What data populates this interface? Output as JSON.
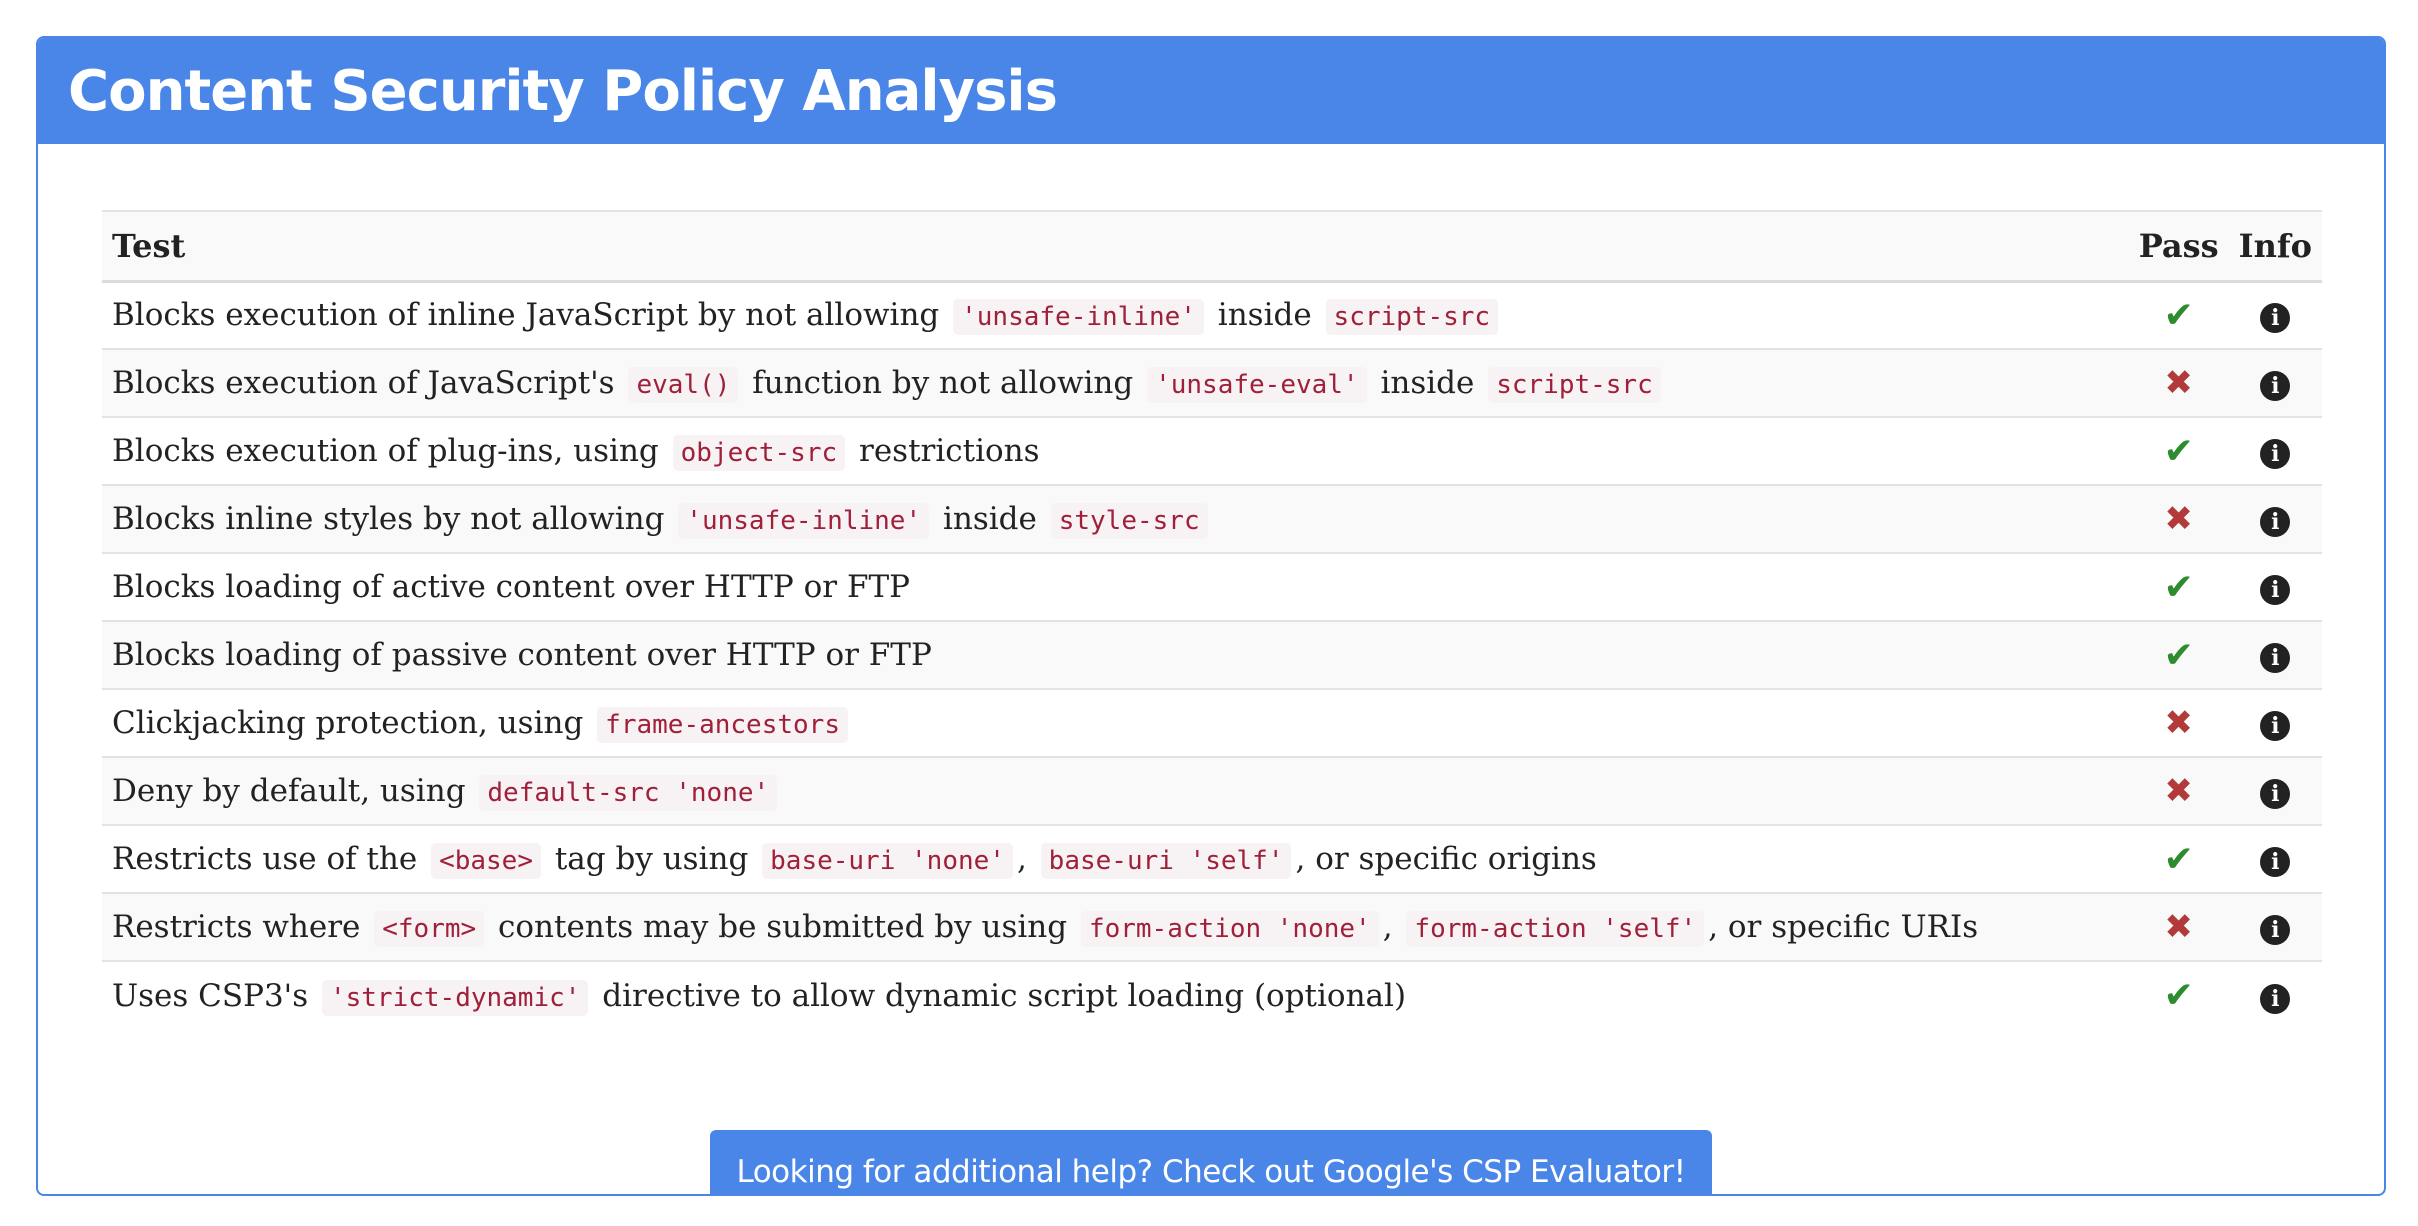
{
  "header": {
    "title": "Content Security Policy Analysis"
  },
  "table": {
    "columns": {
      "test": "Test",
      "pass": "Pass",
      "info": "Info"
    },
    "rows": [
      {
        "parts": [
          {
            "t": "Blocks execution of inline JavaScript by not allowing "
          },
          {
            "c": "'unsafe-inline'"
          },
          {
            "t": " inside "
          },
          {
            "c": "script-src"
          }
        ],
        "pass": true
      },
      {
        "parts": [
          {
            "t": "Blocks execution of JavaScript's "
          },
          {
            "c": "eval()"
          },
          {
            "t": " function by not allowing "
          },
          {
            "c": "'unsafe-eval'"
          },
          {
            "t": " inside "
          },
          {
            "c": "script-src"
          }
        ],
        "pass": false
      },
      {
        "parts": [
          {
            "t": "Blocks execution of plug-ins, using "
          },
          {
            "c": "object-src"
          },
          {
            "t": " restrictions"
          }
        ],
        "pass": true
      },
      {
        "parts": [
          {
            "t": "Blocks inline styles by not allowing "
          },
          {
            "c": "'unsafe-inline'"
          },
          {
            "t": " inside "
          },
          {
            "c": "style-src"
          }
        ],
        "pass": false
      },
      {
        "parts": [
          {
            "t": "Blocks loading of active content over HTTP or FTP"
          }
        ],
        "pass": true
      },
      {
        "parts": [
          {
            "t": "Blocks loading of passive content over HTTP or FTP"
          }
        ],
        "pass": true
      },
      {
        "parts": [
          {
            "t": "Clickjacking protection, using "
          },
          {
            "c": "frame-ancestors"
          }
        ],
        "pass": false
      },
      {
        "parts": [
          {
            "t": "Deny by default, using "
          },
          {
            "c": "default-src 'none'"
          }
        ],
        "pass": false
      },
      {
        "parts": [
          {
            "t": "Restricts use of the "
          },
          {
            "c": "<base>"
          },
          {
            "t": " tag by using "
          },
          {
            "c": "base-uri 'none'"
          },
          {
            "t": ", "
          },
          {
            "c": "base-uri 'self'"
          },
          {
            "t": ", or specific origins"
          }
        ],
        "pass": true
      },
      {
        "parts": [
          {
            "t": "Restricts where "
          },
          {
            "c": "<form>"
          },
          {
            "t": " contents may be submitted by using "
          },
          {
            "c": "form-action 'none'"
          },
          {
            "t": ", "
          },
          {
            "c": "form-action 'self'"
          },
          {
            "t": ", or specific URIs"
          }
        ],
        "pass": false
      },
      {
        "parts": [
          {
            "t": "Uses CSP3's "
          },
          {
            "c": "'strict-dynamic'"
          },
          {
            "t": " directive to allow dynamic script loading (optional)"
          }
        ],
        "pass": true
      }
    ],
    "pass_symbol": "✔",
    "fail_symbol": "✖",
    "info_symbol": "i",
    "pass_color": "#2e8b2e",
    "fail_color": "#b23a3a"
  },
  "cta": {
    "label": "Looking for additional help? Check out Google's CSP Evaluator!"
  },
  "colors": {
    "accent": "#4a86e8",
    "code_text": "#a0203a"
  }
}
